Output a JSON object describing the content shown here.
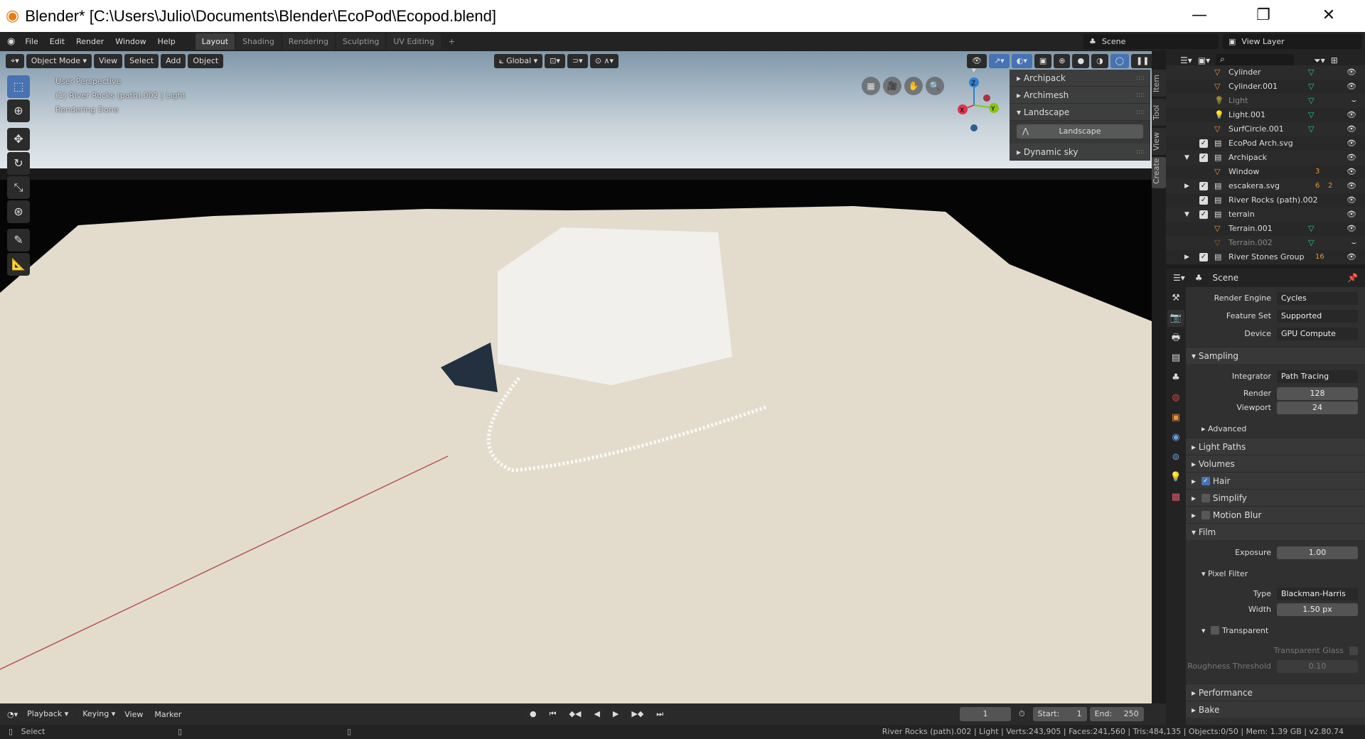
{
  "window": {
    "title": "Blender* [C:\\Users\\Julio\\Documents\\Blender\\EcoPod\\Ecopod.blend]",
    "minimize": "—",
    "maximize": "❐",
    "close": "✕"
  },
  "menu": [
    "File",
    "Edit",
    "Render",
    "Window",
    "Help"
  ],
  "workspaces": [
    {
      "label": "Layout",
      "active": true
    },
    {
      "label": "Shading"
    },
    {
      "label": "Rendering"
    },
    {
      "label": "Sculpting"
    },
    {
      "label": "UV Editing"
    },
    {
      "label": "+"
    }
  ],
  "scene": {
    "name": "Scene",
    "view_layer": "View Layer"
  },
  "viewport": {
    "mode": "Object Mode",
    "menus": [
      "View",
      "Select",
      "Add",
      "Object"
    ],
    "orientation": "Global",
    "overlay_lines": [
      "User Perspective",
      "(1) River Rocks (path).002 | Light",
      "Rendering Done"
    ],
    "gizmo": {
      "x": "X",
      "y": "Y",
      "z": "Z"
    }
  },
  "npanel": {
    "items": [
      {
        "label": "Archipack",
        "open": false
      },
      {
        "label": "Archimesh",
        "open": false
      },
      {
        "label": "Landscape",
        "open": true
      },
      {
        "label": "Dynamic sky",
        "open": false
      }
    ],
    "landscape_button": "Landscape",
    "tabs": [
      "Item",
      "Tool",
      "View",
      "Create"
    ]
  },
  "outliner": {
    "rows": [
      {
        "name": "Cylinder",
        "type": "mesh",
        "indent": 3
      },
      {
        "name": "Cylinder.001",
        "type": "mesh",
        "indent": 3
      },
      {
        "name": "Light",
        "type": "light",
        "indent": 3,
        "hidden": true
      },
      {
        "name": "Light.001",
        "type": "light",
        "indent": 3
      },
      {
        "name": "SurfCircle.001",
        "type": "mesh",
        "indent": 3
      },
      {
        "name": "EcoPod Arch.svg",
        "type": "collection",
        "indent": 2,
        "checked": true
      },
      {
        "name": "Archipack",
        "type": "collection",
        "indent": 2,
        "checked": true,
        "expanded": true
      },
      {
        "name": "Window",
        "type": "mesh",
        "indent": 3,
        "badge": "3"
      },
      {
        "name": "escakera.svg",
        "type": "collection",
        "indent": 2,
        "checked": true,
        "collapsed": true,
        "badge": "6",
        "badge2": "2"
      },
      {
        "name": "River Rocks (path).002",
        "type": "collection",
        "indent": 2,
        "checked": true
      },
      {
        "name": "terrain",
        "type": "collection",
        "indent": 2,
        "checked": true,
        "expanded": true
      },
      {
        "name": "Terrain.001",
        "type": "mesh",
        "indent": 3
      },
      {
        "name": "Terrain.002",
        "type": "mesh",
        "indent": 3,
        "hidden": true
      },
      {
        "name": "River Stones Group",
        "type": "collection",
        "indent": 2,
        "checked": true,
        "collapsed": true,
        "badge": "16"
      }
    ]
  },
  "properties": {
    "context": "Scene",
    "render_engine": {
      "label": "Render Engine",
      "value": "Cycles"
    },
    "feature_set": {
      "label": "Feature Set",
      "value": "Supported"
    },
    "device": {
      "label": "Device",
      "value": "GPU Compute"
    },
    "sampling": "Sampling",
    "integrator": {
      "label": "Integrator",
      "value": "Path Tracing"
    },
    "render": {
      "label": "Render",
      "value": "128"
    },
    "viewport": {
      "label": "Viewport",
      "value": "24"
    },
    "advanced": "Advanced",
    "light_paths": "Light Paths",
    "volumes": "Volumes",
    "hair": {
      "label": "Hair",
      "checked": true
    },
    "simplify": {
      "label": "Simplify",
      "checked": false
    },
    "motion_blur": {
      "label": "Motion Blur",
      "checked": false
    },
    "film": "Film",
    "exposure": {
      "label": "Exposure",
      "value": "1.00"
    },
    "pixel_filter": "Pixel Filter",
    "type": {
      "label": "Type",
      "value": "Blackman-Harris"
    },
    "width": {
      "label": "Width",
      "value": "1.50 px"
    },
    "transparent": {
      "label": "Transparent",
      "checked": false
    },
    "transparent_glass": {
      "label": "Transparent Glass",
      "checked": false
    },
    "roughness": {
      "label": "Roughness Threshold",
      "value": "0.10"
    },
    "performance": "Performance",
    "bake": "Bake"
  },
  "timeline": {
    "menus": [
      "Playback",
      "Keying",
      "View",
      "Marker"
    ],
    "current_frame": "1",
    "start_label": "Start:",
    "start": "1",
    "end_label": "End:",
    "end": "250"
  },
  "status": {
    "left": "Select",
    "right": "River Rocks (path).002 | Light | Verts:243,905 | Faces:241,560 | Tris:484,135 | Objects:0/50 | Mem: 1.39 GB | v2.80.74"
  },
  "colors": {
    "accent": "#4772b3",
    "object_orange": "#e8953a",
    "mesh_data_green": "#25c7a0",
    "title_bg": "#ffffff"
  }
}
